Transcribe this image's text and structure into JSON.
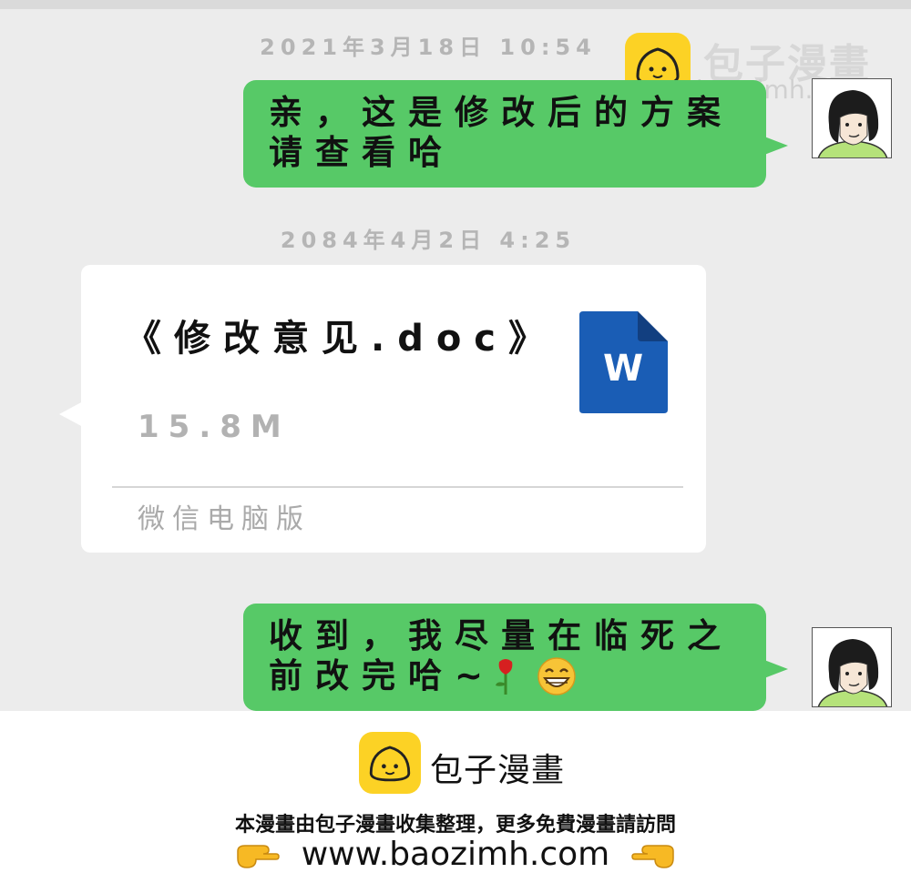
{
  "messages": [
    {
      "timestamp": "2021年3月18日 10:54",
      "line1": "亲，这是修改后的方案",
      "line2": "请查看哈"
    },
    {
      "timestamp": "2084年4月2日 4:25"
    },
    {
      "line1": "收到，我尽量在临死之",
      "line2": "前改完哈~"
    }
  ],
  "file": {
    "name": "《修改意见.doc》",
    "size": "15.8M",
    "source": "微信电脑版",
    "icon_letter": "W",
    "icon": "word-doc-icon"
  },
  "watermark": {
    "name": "包子漫畫",
    "url": "baozimh.com"
  },
  "footer": {
    "brand": "包子漫畫",
    "description": "本漫畫由包子漫畫收集整理，更多免費漫畫請訪問",
    "url": "www.baozimh.com"
  },
  "colors": {
    "chat_bg": "#ececec",
    "bubble_green": "#57c967",
    "word_blue": "#1a5db5",
    "logo_yellow": "#fcd225"
  }
}
